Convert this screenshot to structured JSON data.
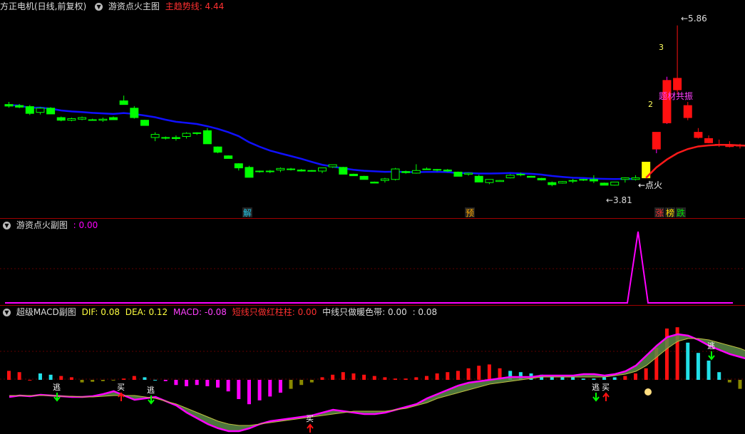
{
  "colors": {
    "up": "#ff1010",
    "down": "#00ff00",
    "ma": "#1010ff",
    "trend": "#ff1a1a",
    "ignite": "#ffff00",
    "magenta": "#ff00ff",
    "cyan": "#22e0e8",
    "olive": "#888800"
  },
  "main": {
    "stock": "方正电机(日线,前复权)",
    "indicator": "游资点火主图",
    "trend_label": "主趋势线: 4.44",
    "high_label": "5.86",
    "low_label": "3.81",
    "fire_label": "←点火",
    "mark1": "2",
    "mark2": "3",
    "theme_label": "题材共振",
    "tags": [
      {
        "t": "解",
        "c": "#22c8e8"
      },
      {
        "t": "预",
        "c": "#ffaa00"
      },
      {
        "t": "涨",
        "c": "#ff3030"
      },
      {
        "t": "榜",
        "c": "#ffdd00"
      },
      {
        "t": "跌",
        "c": "#00dd00"
      }
    ]
  },
  "sub1": {
    "name": "游资点火副图",
    "value": ": 0.00"
  },
  "sub2": {
    "name": "超级MACD副图",
    "dif": "DIF: 0.08",
    "dea": "DEA: 0.12",
    "macd": "MACD: -0.08",
    "short": "短线只做红柱柱: 0.00",
    "mid": "中线只做暖色带: 0.00",
    "tail": ": 0.08",
    "escape": "逃",
    "buy": "买"
  },
  "chart_data": [
    {
      "type": "candlestick",
      "title": "方正电机(日线,前复权)",
      "low": 3.81,
      "high": 5.86,
      "ohlc": [
        [
          4.35,
          4.4,
          4.29,
          4.32
        ],
        [
          4.33,
          4.36,
          4.28,
          4.3
        ],
        [
          4.31,
          4.34,
          4.15,
          4.18
        ],
        [
          4.2,
          4.3,
          4.16,
          4.28
        ],
        [
          4.28,
          4.3,
          4.17,
          4.17
        ],
        [
          4.1,
          4.12,
          4.03,
          4.05
        ],
        [
          4.05,
          4.1,
          4.03,
          4.08
        ],
        [
          4.07,
          4.12,
          4.05,
          4.1
        ],
        [
          4.06,
          4.08,
          4.04,
          4.05
        ],
        [
          4.05,
          4.1,
          4.02,
          4.07
        ],
        [
          4.1,
          4.12,
          4.06,
          4.06
        ],
        [
          4.42,
          4.52,
          4.35,
          4.35
        ],
        [
          4.28,
          4.32,
          4.08,
          4.1
        ],
        [
          4.05,
          4.06,
          3.95,
          3.95
        ],
        [
          3.72,
          3.82,
          3.65,
          3.78
        ],
        [
          3.71,
          3.74,
          3.68,
          3.72
        ],
        [
          3.72,
          3.76,
          3.66,
          3.7
        ],
        [
          3.74,
          3.82,
          3.7,
          3.8
        ],
        [
          3.8,
          3.82,
          3.77,
          3.81
        ],
        [
          3.85,
          3.9,
          3.6,
          3.6
        ],
        [
          3.54,
          3.55,
          3.42,
          3.44
        ],
        [
          3.37,
          3.38,
          3.32,
          3.32
        ],
        [
          3.22,
          3.23,
          3.09,
          3.14
        ],
        [
          3.15,
          3.18,
          2.96,
          2.96
        ],
        [
          3.08,
          3.09,
          3.05,
          3.07
        ],
        [
          3.08,
          3.1,
          3.04,
          3.07
        ],
        [
          3.1,
          3.15,
          3.06,
          3.13
        ],
        [
          3.12,
          3.14,
          3.09,
          3.11
        ],
        [
          3.1,
          3.12,
          3.07,
          3.08
        ],
        [
          3.09,
          3.1,
          3.07,
          3.09
        ],
        [
          3.08,
          3.12,
          3.04,
          3.14
        ],
        [
          3.16,
          3.2,
          3.14,
          3.2
        ],
        [
          3.15,
          3.16,
          3.02,
          3.02
        ],
        [
          3.02,
          3.03,
          2.99,
          2.99
        ],
        [
          2.98,
          2.99,
          2.92,
          2.92
        ],
        [
          2.87,
          2.88,
          2.85,
          2.85
        ],
        [
          2.9,
          2.95,
          2.86,
          2.93
        ],
        [
          2.92,
          3.14,
          2.9,
          3.12
        ],
        [
          3.07,
          3.09,
          3.03,
          3.05
        ],
        [
          3.04,
          3.21,
          3.03,
          3.09
        ],
        [
          3.12,
          3.15,
          3.1,
          3.12
        ],
        [
          3.11,
          3.12,
          3.07,
          3.1
        ],
        [
          3.1,
          3.12,
          3.06,
          3.08
        ],
        [
          3.06,
          3.07,
          2.98,
          2.98
        ],
        [
          3.02,
          3.05,
          2.99,
          3.04
        ],
        [
          2.98,
          3.01,
          2.87,
          2.87
        ],
        [
          2.86,
          2.88,
          2.83,
          2.92
        ],
        [
          2.88,
          2.91,
          2.88,
          2.9
        ],
        [
          2.95,
          3.02,
          2.94,
          3.0
        ],
        [
          3.02,
          3.05,
          2.98,
          3.02
        ],
        [
          2.98,
          2.99,
          2.96,
          2.96
        ],
        [
          2.94,
          2.95,
          2.9,
          2.91
        ],
        [
          2.86,
          2.88,
          2.79,
          2.82
        ],
        [
          2.85,
          2.89,
          2.84,
          2.88
        ],
        [
          2.89,
          2.93,
          2.85,
          2.9
        ],
        [
          2.91,
          2.93,
          2.89,
          2.92
        ],
        [
          2.92,
          3.0,
          2.85,
          2.89
        ],
        [
          2.85,
          2.86,
          2.81,
          2.81
        ],
        [
          2.81,
          2.87,
          2.8,
          2.87
        ],
        [
          2.92,
          2.96,
          2.86,
          2.95
        ],
        [
          2.92,
          3.0,
          2.9,
          2.95
        ],
        [
          2.95,
          3.25,
          2.95,
          3.25
        ],
        [
          3.5,
          3.65,
          3.42,
          3.82
        ],
        [
          4.0,
          4.88,
          3.98,
          4.81
        ],
        [
          4.85,
          5.86,
          4.55,
          4.63
        ],
        [
          4.33,
          4.4,
          4.05,
          4.1
        ],
        [
          3.82,
          3.9,
          3.7,
          3.72
        ],
        [
          3.7,
          3.76,
          3.61,
          3.62
        ],
        [
          3.58,
          3.68,
          3.54,
          3.59
        ],
        [
          3.56,
          3.65,
          3.53,
          3.56
        ],
        [
          3.57,
          3.6,
          3.51,
          3.56
        ],
        [
          3.56,
          3.6,
          3.55,
          3.56
        ]
      ]
    },
    {
      "type": "line",
      "title": "游资点火副图",
      "values_note": "spike",
      "spike_index": 64,
      "spike_value": 1.0,
      "base": 0.0,
      "value": 0.0
    },
    {
      "type": "bar",
      "title": "超级MACD副图",
      "dif": 0.08,
      "dea": 0.12,
      "macd": -0.08
    }
  ]
}
